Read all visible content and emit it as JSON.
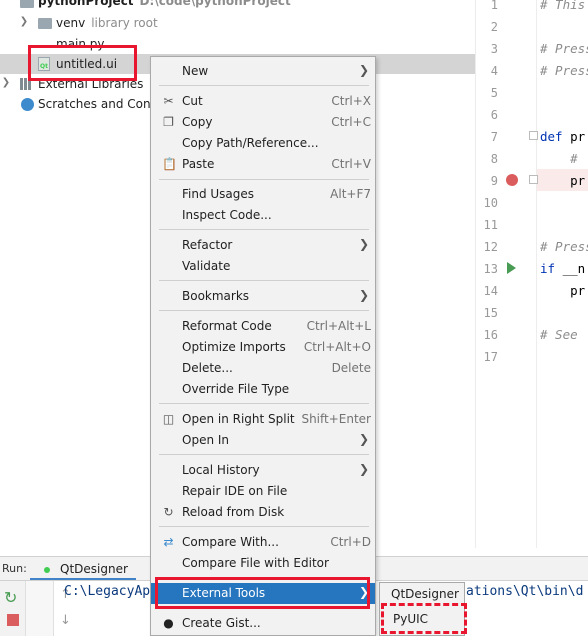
{
  "tree": {
    "root_label": "pythonProject",
    "root_path": "D:\\code\\pythonProject",
    "venv_label": "venv",
    "venv_sub": "library root",
    "main_label": "main.py",
    "ui_label": "untitled.ui",
    "ext_libs_label": "External Libraries",
    "scratches_label": "Scratches and Consoles"
  },
  "editor": {
    "line_numbers": [
      "1",
      "2",
      "3",
      "4",
      "5",
      "6",
      "7",
      "8",
      "9",
      "10",
      "11",
      "12",
      "13",
      "14",
      "15",
      "16",
      "17"
    ],
    "lines": {
      "l1": "# This",
      "l3": "# Press",
      "l4": "# Press",
      "l7_kw": "def",
      "l7_rest": " pr",
      "l8": "    #",
      "l9": "    pr",
      "l12": "# Press",
      "l13_kw": "if",
      "l13_rest": " __n",
      "l14": "    pr",
      "l16": "# See"
    }
  },
  "context_menu": {
    "new": "New",
    "cut": "Cut",
    "cut_sc": "Ctrl+X",
    "copy": "Copy",
    "copy_sc": "Ctrl+C",
    "copy_path": "Copy Path/Reference...",
    "paste": "Paste",
    "paste_sc": "Ctrl+V",
    "find_usages": "Find Usages",
    "find_usages_sc": "Alt+F7",
    "inspect_code": "Inspect Code...",
    "refactor": "Refactor",
    "validate": "Validate",
    "bookmarks": "Bookmarks",
    "reformat": "Reformat Code",
    "reformat_sc": "Ctrl+Alt+L",
    "optimize": "Optimize Imports",
    "optimize_sc": "Ctrl+Alt+O",
    "delete": "Delete...",
    "delete_sc": "Delete",
    "override": "Override File Type",
    "open_split": "Open in Right Split",
    "open_split_sc": "Shift+Enter",
    "open_in": "Open In",
    "local_history": "Local History",
    "repair_ide": "Repair IDE on File",
    "reload": "Reload from Disk",
    "compare_with": "Compare With...",
    "compare_with_sc": "Ctrl+D",
    "compare_editor": "Compare File with Editor",
    "external_tools": "External Tools",
    "create_gist": "Create Gist..."
  },
  "submenu": {
    "group": "QtDesigner",
    "item": "PyUIC"
  },
  "run_panel": {
    "label": "Run:",
    "tab": "QtDesigner",
    "console_left": "C:\\LegacyAp",
    "console_right": "ations\\Qt\\bin\\d"
  },
  "colors": {
    "highlight": "#2675bf",
    "annotation_red": "#e8162f",
    "qt_green": "#41cd52"
  }
}
